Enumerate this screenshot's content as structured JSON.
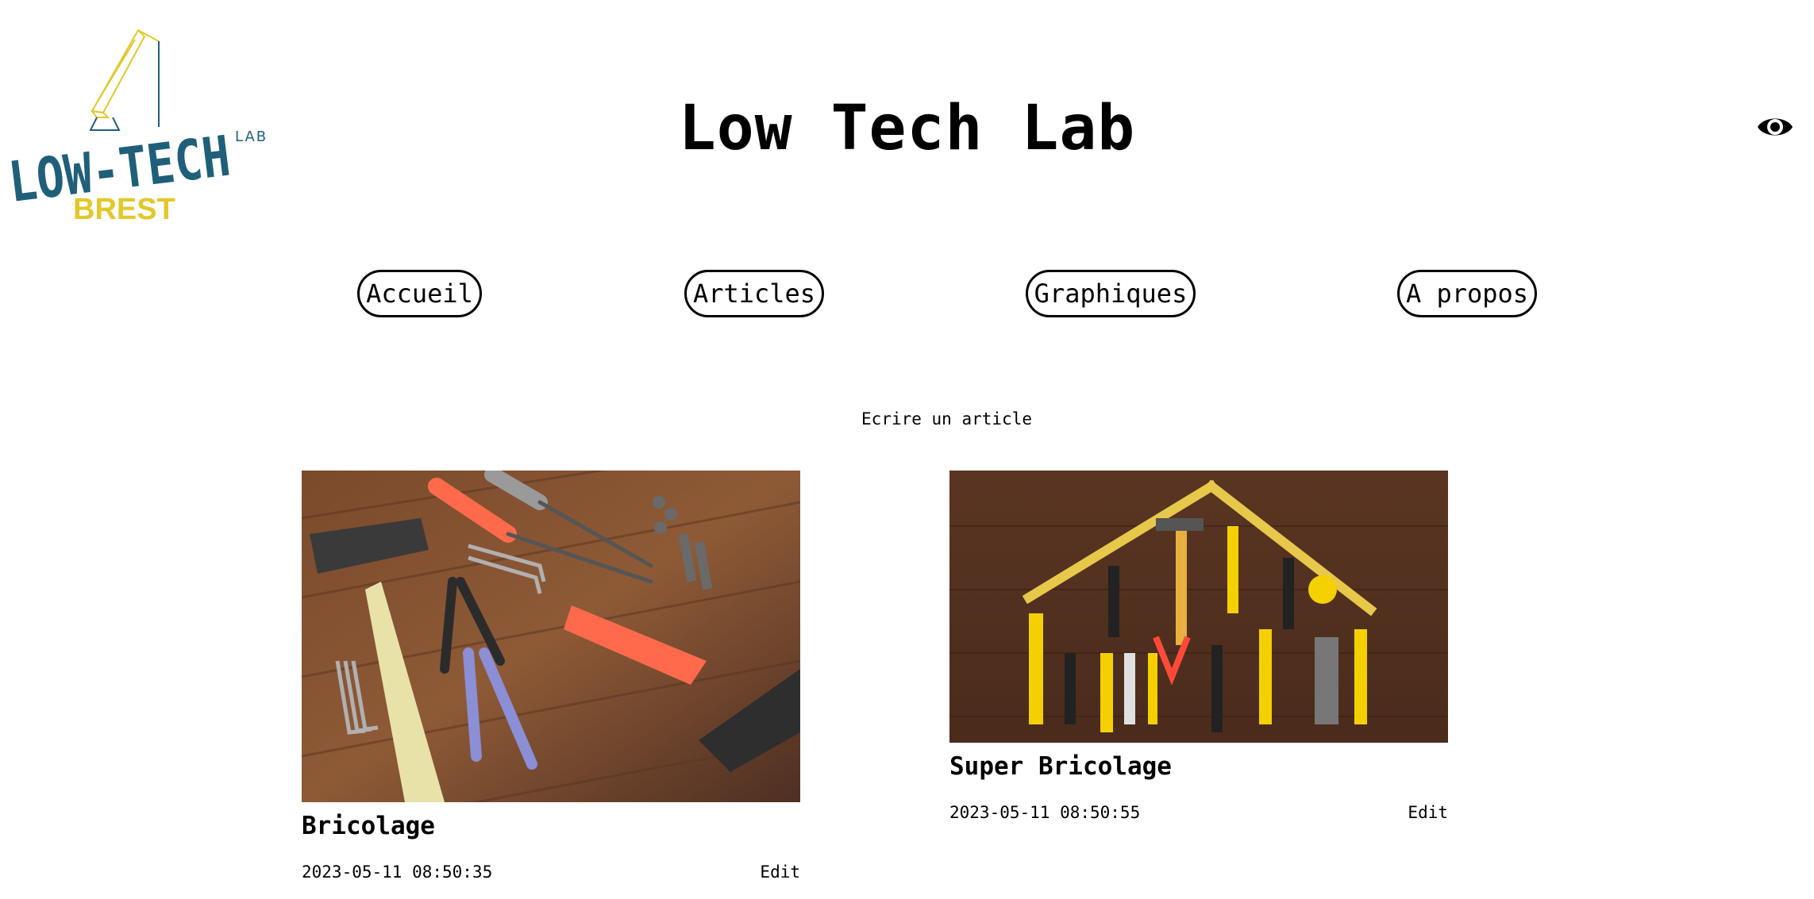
{
  "header": {
    "logo_text_main": "LOW-TECH",
    "logo_text_small": "LAB",
    "logo_text_city": "BREST",
    "title": "Low Tech Lab",
    "toggle_icon": "eye-icon"
  },
  "nav": {
    "items": [
      {
        "label": "Accueil"
      },
      {
        "label": "Articles"
      },
      {
        "label": "Graphiques"
      },
      {
        "label": "A propos"
      }
    ]
  },
  "write_article_label": "Ecrire un article",
  "articles": [
    {
      "title": "Bricolage",
      "date": "2023-05-11 08:50:35",
      "edit_label": "Edit",
      "image": "tools-on-wood-photo"
    },
    {
      "title": "Super Bricolage",
      "date": "2023-05-11 08:50:55",
      "edit_label": "Edit",
      "image": "tools-house-shape-photo"
    }
  ],
  "colors": {
    "logo_blue": "#1f5f7a",
    "logo_yellow": "#e3c82b",
    "text": "#000000",
    "background": "#ffffff"
  }
}
